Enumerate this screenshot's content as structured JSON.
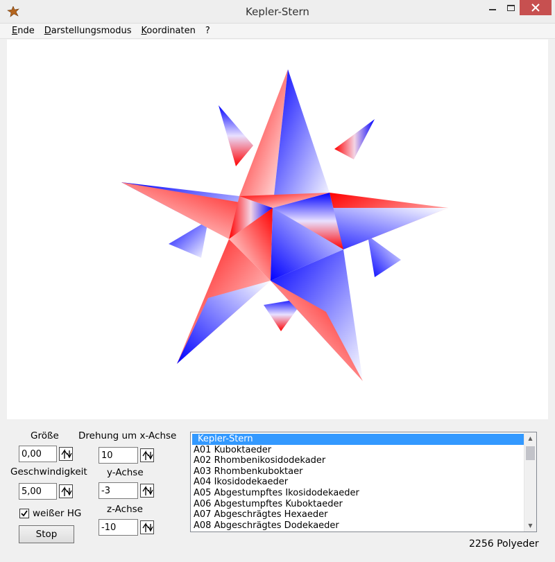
{
  "window": {
    "title": "Kepler-Stern",
    "icons": {
      "app": "star-app-icon",
      "minimize": "minimize-icon",
      "maximize": "maximize-icon",
      "close": "close-icon"
    }
  },
  "menu": {
    "items": [
      {
        "accel": "E",
        "rest": "nde"
      },
      {
        "accel": "D",
        "rest": "arstellungsmodus"
      },
      {
        "accel": "K",
        "rest": "oordinaten"
      },
      {
        "accel": "",
        "rest": "?"
      }
    ]
  },
  "controls": {
    "size_label": "Größe",
    "size_value": "0,00",
    "speed_label": "Geschwindigkeit",
    "speed_value": "5,00",
    "rot_x_label": "Drehung um x-Achse",
    "rot_x_value": "10",
    "rot_y_label": "y-Achse",
    "rot_y_value": "-3",
    "rot_z_label": "z-Achse",
    "rot_z_value": "-10",
    "white_bg_label": "weißer HG",
    "white_bg_checked": true,
    "stop_label": "Stop"
  },
  "polyhedra": {
    "selected": "Kepler-Stern",
    "items": [
      "A01 Kuboktaeder",
      "A02 Rhombenikosidodekader",
      "A03 Rhombenkuboktaer",
      "A04 Ikosidodekaeder",
      "A05 Abgestumpftes Ikosidodekaeder",
      "A06 Abgestumpftes Kuboktaeder",
      "A07 Abgeschrägtes Hexaeder",
      "A08 Abgeschrägtes Dodekaeder"
    ]
  },
  "status": {
    "count_text": "2256 Polyeder"
  },
  "colors": {
    "red": "#ff0000",
    "blue": "#0000ff",
    "white": "#ffffff",
    "selection": "#3399ff"
  }
}
